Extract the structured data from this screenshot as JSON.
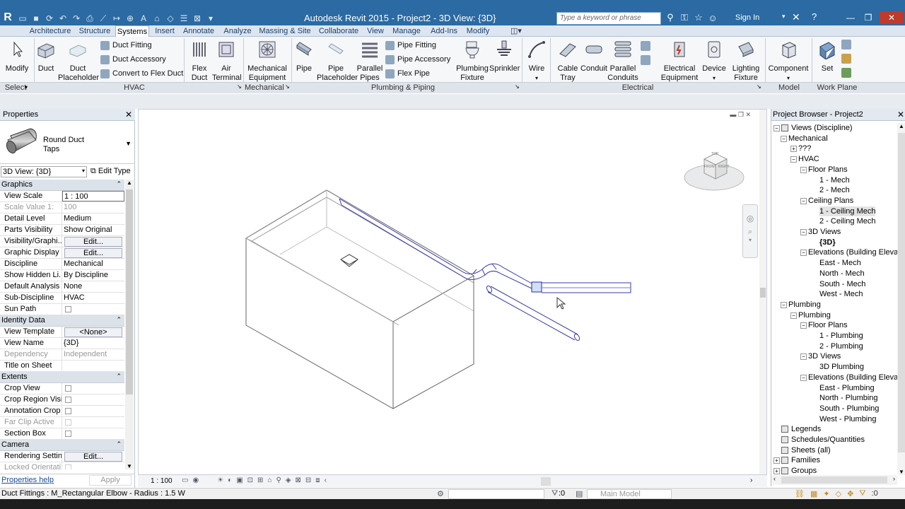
{
  "app": {
    "title": "Autodesk Revit 2015  -  Project2 - 3D View: {3D}",
    "sign_in": "Sign In"
  },
  "search": {
    "placeholder": "Type a keyword or phrase"
  },
  "tabs": [
    "Architecture",
    "Structure",
    "Systems",
    "Insert",
    "Annotate",
    "Analyze",
    "Massing & Site",
    "Collaborate",
    "View",
    "Manage",
    "Add-Ins",
    "Modify"
  ],
  "active_tab": "Systems",
  "ribbon": {
    "modify": "Modify",
    "duct": "Duct",
    "duct_placeholder": [
      "Duct",
      "Placeholder"
    ],
    "duct_fitting": "Duct  Fitting",
    "duct_accessory": "Duct  Accessory",
    "convert_flex": "Convert to  Flex Duct",
    "flex_duct": [
      "Flex",
      "Duct"
    ],
    "air_terminal": [
      "Air",
      "Terminal"
    ],
    "mech_equipment": [
      "Mechanical",
      "Equipment"
    ],
    "pipe": "Pipe",
    "pipe_placeholder": [
      "Pipe",
      "Placeholder"
    ],
    "parallel_pipes": [
      "Parallel",
      "Pipes"
    ],
    "pipe_fitting": "Pipe  Fitting",
    "pipe_accessory": "Pipe  Accessory",
    "flex_pipe": "Flex  Pipe",
    "plumbing_fixture": [
      "Plumbing",
      "Fixture"
    ],
    "sprinkler": "Sprinkler",
    "wire": "Wire",
    "cable_tray": [
      "Cable",
      "Tray"
    ],
    "conduit": "Conduit",
    "parallel_conduits": [
      "Parallel",
      "Conduits"
    ],
    "electrical_equipment": [
      "Electrical",
      "Equipment"
    ],
    "device": "Device",
    "lighting_fixture": [
      "Lighting",
      "Fixture"
    ],
    "component": "Component",
    "set": "Set"
  },
  "panels": {
    "select": "Select",
    "hvac": "HVAC",
    "mechanical": "Mechanical",
    "plumbing": "Plumbing & Piping",
    "electrical": "Electrical",
    "model": "Model",
    "work_plane": "Work Plane"
  },
  "properties": {
    "header": "Properties",
    "type_name": [
      "Round Duct",
      "Taps"
    ],
    "view_selector": "3D View: {3D}",
    "edit_type": "Edit Type",
    "groups": [
      {
        "name": "Graphics",
        "rows": [
          {
            "k": "View Scale",
            "v": "1 : 100",
            "kind": "input"
          },
          {
            "k": "Scale Value    1:",
            "v": "100",
            "kind": "dis"
          },
          {
            "k": "Detail Level",
            "v": "Medium"
          },
          {
            "k": "Parts Visibility",
            "v": "Show Original"
          },
          {
            "k": "Visibility/Graphi...",
            "v": "Edit...",
            "kind": "btn"
          },
          {
            "k": "Graphic Display ...",
            "v": "Edit...",
            "kind": "btn"
          },
          {
            "k": "Discipline",
            "v": "Mechanical"
          },
          {
            "k": "Show Hidden Li...",
            "v": "By Discipline"
          },
          {
            "k": "Default Analysis ...",
            "v": "None"
          },
          {
            "k": "Sub-Discipline",
            "v": "HVAC"
          },
          {
            "k": "Sun Path",
            "v": "",
            "kind": "chk"
          }
        ]
      },
      {
        "name": "Identity Data",
        "rows": [
          {
            "k": "View Template",
            "v": "<None>",
            "kind": "btn"
          },
          {
            "k": "View Name",
            "v": "{3D}"
          },
          {
            "k": "Dependency",
            "v": "Independent",
            "kind": "dis"
          },
          {
            "k": "Title on Sheet",
            "v": ""
          }
        ]
      },
      {
        "name": "Extents",
        "rows": [
          {
            "k": "Crop View",
            "v": "",
            "kind": "chk"
          },
          {
            "k": "Crop Region Visi...",
            "v": "",
            "kind": "chk"
          },
          {
            "k": "Annotation Crop",
            "v": "",
            "kind": "chk"
          },
          {
            "k": "Far Clip Active",
            "v": "",
            "kind": "chkdis"
          },
          {
            "k": "Section Box",
            "v": "",
            "kind": "chk"
          }
        ]
      },
      {
        "name": "Camera",
        "rows": [
          {
            "k": "Rendering Settin...",
            "v": "Edit...",
            "kind": "btn"
          },
          {
            "k": "Locked Orientati...",
            "v": "",
            "kind": "chkdis"
          }
        ]
      }
    ],
    "help_link": "Properties help",
    "apply": "Apply"
  },
  "browser": {
    "header": "Project Browser - Project2",
    "items": [
      {
        "t": "Views (Discipline)",
        "lvl": 0,
        "tog": "-",
        "icon": true
      },
      {
        "t": "Mechanical",
        "lvl": 1,
        "tog": "-"
      },
      {
        "t": "???",
        "lvl": 2,
        "tog": "+"
      },
      {
        "t": "HVAC",
        "lvl": 2,
        "tog": "-"
      },
      {
        "t": "Floor Plans",
        "lvl": 3,
        "tog": "-"
      },
      {
        "t": "1 - Mech",
        "lvl": 4
      },
      {
        "t": "2 - Mech",
        "lvl": 4
      },
      {
        "t": "Ceiling Plans",
        "lvl": 3,
        "tog": "-"
      },
      {
        "t": "1 - Ceiling Mech",
        "lvl": 4,
        "sel": true
      },
      {
        "t": "2 - Ceiling Mech",
        "lvl": 4
      },
      {
        "t": "3D Views",
        "lvl": 3,
        "tog": "-"
      },
      {
        "t": "{3D}",
        "lvl": 4,
        "bold": true
      },
      {
        "t": "Elevations (Building Elevat",
        "lvl": 3,
        "tog": "-"
      },
      {
        "t": "East - Mech",
        "lvl": 4
      },
      {
        "t": "North - Mech",
        "lvl": 4
      },
      {
        "t": "South - Mech",
        "lvl": 4
      },
      {
        "t": "West - Mech",
        "lvl": 4
      },
      {
        "t": "Plumbing",
        "lvl": 1,
        "tog": "-"
      },
      {
        "t": "Plumbing",
        "lvl": 2,
        "tog": "-"
      },
      {
        "t": "Floor Plans",
        "lvl": 3,
        "tog": "-"
      },
      {
        "t": "1 - Plumbing",
        "lvl": 4
      },
      {
        "t": "2 - Plumbing",
        "lvl": 4
      },
      {
        "t": "3D Views",
        "lvl": 3,
        "tog": "-"
      },
      {
        "t": "3D Plumbing",
        "lvl": 4
      },
      {
        "t": "Elevations (Building Elevat",
        "lvl": 3,
        "tog": "-"
      },
      {
        "t": "East - Plumbing",
        "lvl": 4
      },
      {
        "t": "North - Plumbing",
        "lvl": 4
      },
      {
        "t": "South - Plumbing",
        "lvl": 4
      },
      {
        "t": "West - Plumbing",
        "lvl": 4
      },
      {
        "t": "Legends",
        "lvl": 0,
        "icon": true
      },
      {
        "t": "Schedules/Quantities",
        "lvl": 0,
        "icon": true
      },
      {
        "t": "Sheets (all)",
        "lvl": 0,
        "icon": true
      },
      {
        "t": "Families",
        "lvl": 0,
        "tog": "+",
        "icon": true
      },
      {
        "t": "Groups",
        "lvl": 0,
        "tog": "+",
        "icon": true
      }
    ]
  },
  "viewcube": {
    "top": "TOP",
    "front": "FRONT",
    "right": "RIGHT"
  },
  "viewbar": {
    "scale": "1 : 100"
  },
  "status": {
    "text": "Duct Fittings : M_Rectangular Elbow - Radius : 1.5 W",
    "count": ":0",
    "model": "Main Model"
  }
}
